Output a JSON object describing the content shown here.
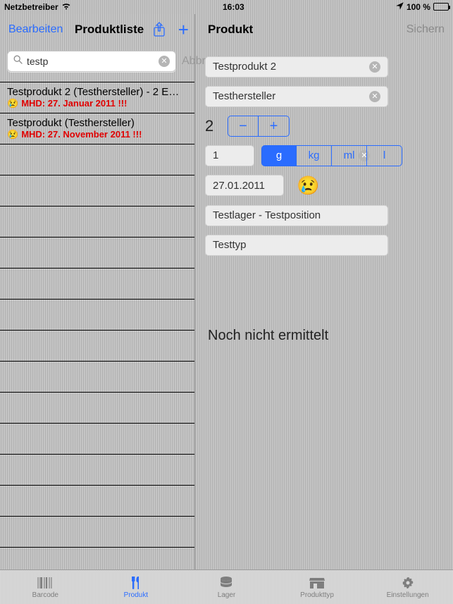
{
  "statusbar": {
    "carrier": "Netzbetreiber",
    "time": "16:03",
    "battery_pct": "100 %"
  },
  "left": {
    "edit_label": "Bearbeiten",
    "title": "Produktliste",
    "search_value": "testp",
    "cancel_label": "Abbrechen",
    "items": [
      {
        "title": "Testprodukt 2 (Testhersteller) - 2 E…",
        "mhd_text": "MHD: 27. Januar 2011 !!!"
      },
      {
        "title": "Testprodukt (Testhersteller)",
        "mhd_text": "MHD: 27. November 2011 !!!"
      }
    ]
  },
  "right": {
    "title": "Produkt",
    "save_label": "Sichern",
    "name_value": "Testprodukt 2",
    "maker_value": "Testhersteller",
    "qty_value": "2",
    "amount_value": "1",
    "units": [
      "g",
      "kg",
      "ml",
      "l"
    ],
    "unit_selected_index": 0,
    "date_value": "27.01.2011",
    "expiry_emoji": "😢",
    "storage_value": "Testlager - Testposition",
    "type_value": "Testtyp",
    "status_text": "Noch nicht ermittelt"
  },
  "tabs": {
    "items": [
      {
        "label": "Barcode"
      },
      {
        "label": "Produkt"
      },
      {
        "label": "Lager"
      },
      {
        "label": "Produkttyp"
      },
      {
        "label": "Einstellungen"
      }
    ],
    "active_index": 1
  },
  "icons": {
    "warn_emoji": "😢"
  }
}
